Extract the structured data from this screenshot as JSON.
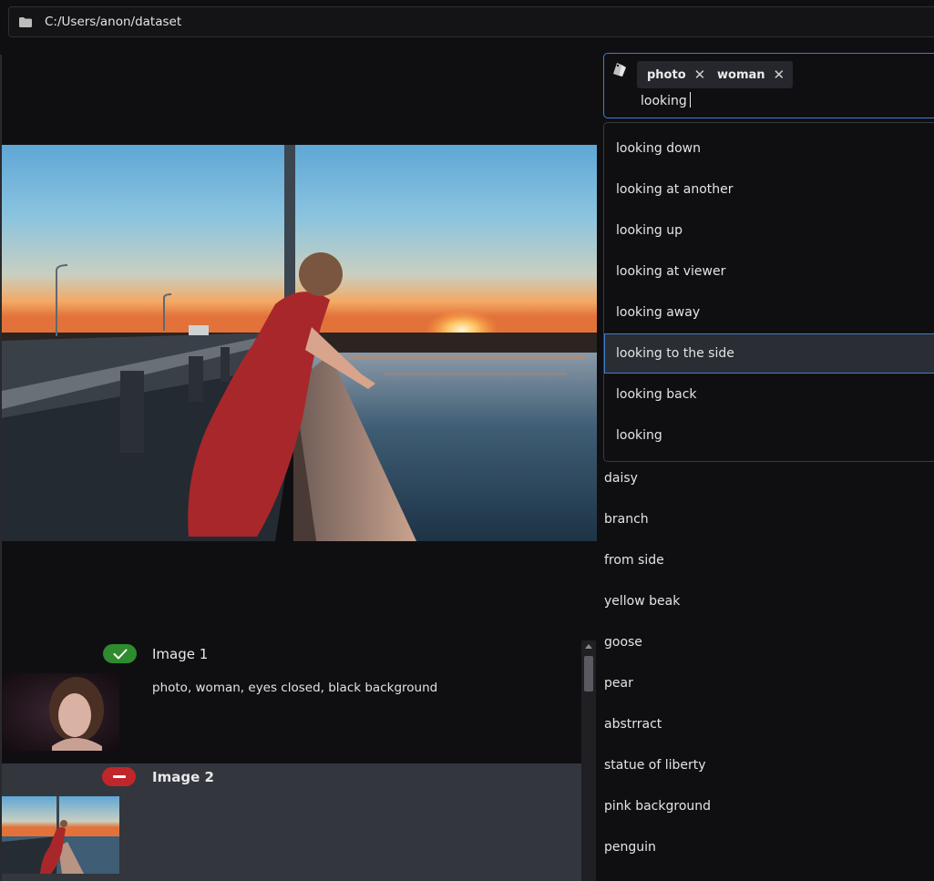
{
  "path_bar": {
    "path": "C:/Users/anon/dataset",
    "icon": "folder-icon"
  },
  "tag_input": {
    "icon": "tags-icon",
    "chips": [
      {
        "label": "photo"
      },
      {
        "label": "woman"
      }
    ],
    "remove_glyph": "✕",
    "typed_value": "looking"
  },
  "suggestions": [
    "looking down",
    "looking at another",
    "looking up",
    "looking at viewer",
    "looking away",
    "looking to the side",
    "looking back",
    "looking"
  ],
  "selected_suggestion": "looking to the side",
  "tag_list": [
    "daisy",
    "branch",
    "from side",
    "yellow beak",
    "goose",
    "pear",
    "abstrract",
    "statue of liberty",
    "pink background",
    "penguin"
  ],
  "images": [
    {
      "title": "Image 1",
      "status": "check-icon",
      "caption": "photo, woman, eyes closed, black background"
    },
    {
      "title": "Image 2",
      "status": "minus-icon",
      "caption": ""
    }
  ],
  "colors": {
    "accent": "#3d7ecf",
    "ok": "#2e8b2e",
    "bad": "#c0262a",
    "background": "#0f0f12"
  }
}
